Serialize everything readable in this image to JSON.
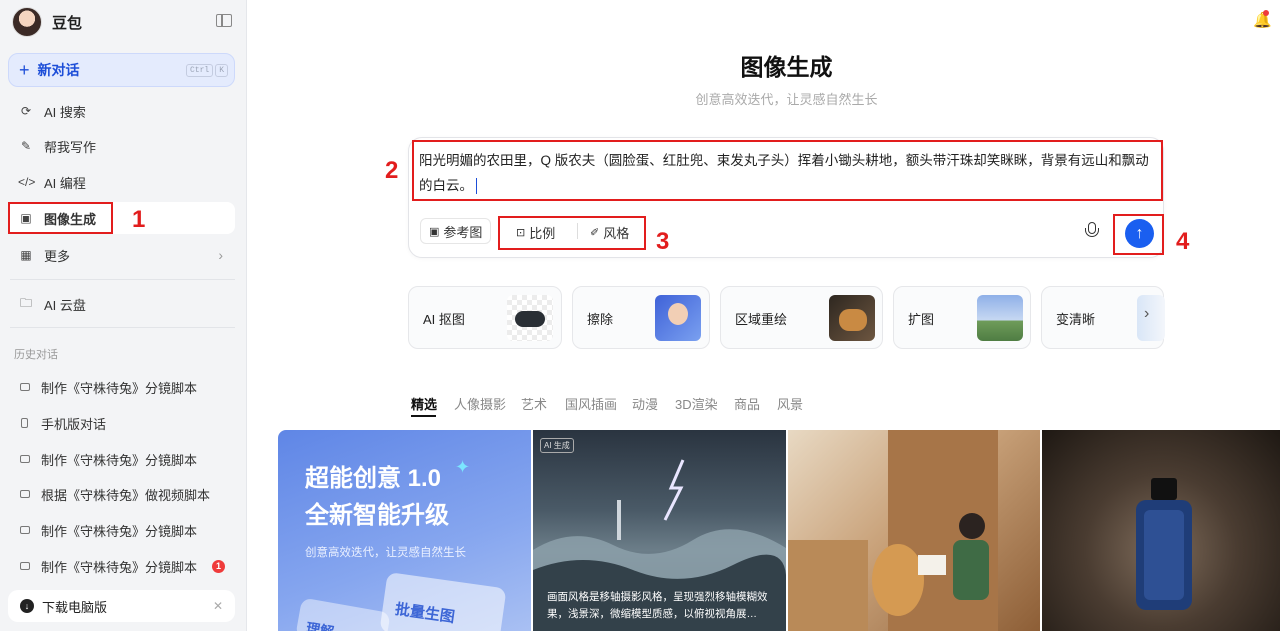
{
  "sidebar": {
    "brand": "豆包",
    "new_chat": "新对话",
    "shortcut": [
      "Ctrl",
      "K"
    ],
    "nav": [
      {
        "label": "AI 搜索",
        "icon": "search-spark-icon"
      },
      {
        "label": "帮我写作",
        "icon": "pen-icon"
      },
      {
        "label": "AI 编程",
        "icon": "code-icon"
      },
      {
        "label": "图像生成",
        "icon": "image-icon",
        "active": true
      },
      {
        "label": "更多",
        "icon": "grid-icon"
      }
    ],
    "cloud": "AI 云盘",
    "history_title": "历史对话",
    "history": [
      {
        "label": "制作《守株待兔》分镜脚本"
      },
      {
        "label": "手机版对话"
      },
      {
        "label": "制作《守株待兔》分镜脚本"
      },
      {
        "label": "根据《守株待兔》做视频脚本"
      },
      {
        "label": "制作《守株待兔》分镜脚本"
      },
      {
        "label": "制作《守株待兔》分镜脚本",
        "badge": "1"
      }
    ],
    "download": "下载电脑版"
  },
  "main": {
    "title": "图像生成",
    "subtitle": "创意高效迭代，让灵感自然生长",
    "prompt": "阳光明媚的农田里，Q 版农夫（圆脸蛋、红肚兜、束发丸子头）挥着小锄头耕地，额头带汗珠却笑眯眯，背景有远山和飘动的白云。",
    "tools": {
      "reference": "参考图",
      "ratio": "比例",
      "style": "风格"
    },
    "features": [
      "AI 抠图",
      "擦除",
      "区域重绘",
      "扩图",
      "变清晰"
    ],
    "tabs": [
      "精选",
      "人像摄影",
      "艺术",
      "国风插画",
      "动漫",
      "3D渲染",
      "商品",
      "风景"
    ],
    "gallery": {
      "promo_title_1": "超能创意 1.0",
      "promo_title_2": "全新智能升级",
      "promo_sub": "创意高效迭代，让灵感自然生长",
      "promo_card_1": "批量生图",
      "promo_card_2": "理解",
      "ai_badge": "AI 生成",
      "caption": "画面风格是移轴摄影风格，呈现强烈移轴模糊效果，浅景深，微缩模型质感，以俯视视角展…"
    }
  },
  "annotations": [
    "1",
    "2",
    "3",
    "4"
  ],
  "colors": {
    "accent": "#1a5ff0",
    "highlight": "#e21d1d"
  }
}
